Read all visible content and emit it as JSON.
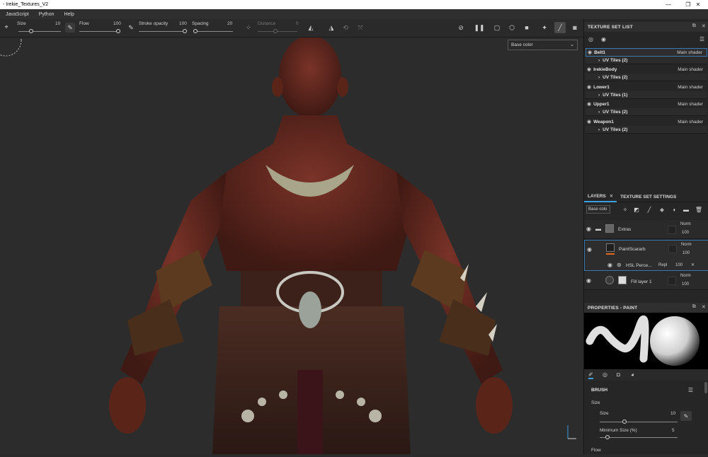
{
  "window": {
    "title": "- Irekie_Textures_V2",
    "controls": {
      "minimize": "—",
      "maximize": "❐",
      "close": "✕"
    }
  },
  "menu": [
    "JavaScript",
    "Python",
    "Help"
  ],
  "toolbar": {
    "size_label": "Size",
    "size_value": "10",
    "flow_label": "Flow",
    "flow_value": "100",
    "stroke_opacity_label": "Stroke opacity",
    "stroke_opacity_value": "100",
    "spacing_label": "Spacing",
    "spacing_value": "20",
    "distance_label": "Distance",
    "distance_value": "0"
  },
  "viewport": {
    "channel_dropdown": "Base color"
  },
  "texture_set_list": {
    "title": "TEXTURE SET LIST",
    "items": [
      {
        "name": "Belt1",
        "shader": "Main shader",
        "uv": "UV Tiles (2)"
      },
      {
        "name": "IrekieBody",
        "shader": "Main shader",
        "uv": "UV Tiles (2)"
      },
      {
        "name": "Lower1",
        "shader": "Main shader",
        "uv": "UV Tiles (1)"
      },
      {
        "name": "Upper1",
        "shader": "Main shader",
        "uv": "UV Tiles (2)"
      },
      {
        "name": "Weapon1",
        "shader": "Main shader",
        "uv": "UV Tiles (2)"
      }
    ]
  },
  "layers": {
    "tab_layers": "LAYERS",
    "tab_settings": "TEXTURE SET SETTINGS",
    "channel": "Base colo",
    "items": [
      {
        "name": "Extras",
        "blend": "Norm",
        "opacity": "100"
      },
      {
        "name": "PaintScararb",
        "blend": "Norm",
        "opacity": "100"
      },
      {
        "name": "HSL Perce...",
        "blend": "Repl",
        "opacity": "100"
      },
      {
        "name": "Fill layer 1",
        "blend": "Norm",
        "opacity": "100"
      }
    ]
  },
  "properties": {
    "title": "PROPERTIES - PAINT",
    "brush_header": "BRUSH",
    "size_section": "Size",
    "size_label": "Size",
    "size_value": "10",
    "min_size_label": "Minimum Size (%)",
    "min_size_value": "5",
    "flow_label": "Flow"
  },
  "colors": {
    "accent": "#3aa0e0",
    "skin": "#6b2a22",
    "panel_bg": "#262626"
  }
}
